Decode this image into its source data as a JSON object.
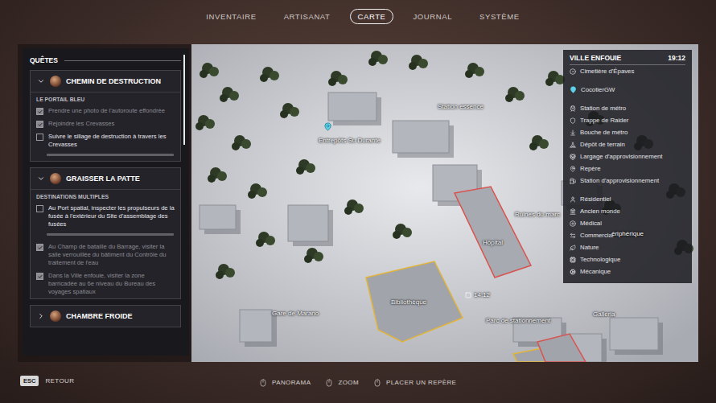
{
  "nav": {
    "tabs": [
      {
        "label": "INVENTAIRE",
        "selected": false
      },
      {
        "label": "ARTISANAT",
        "selected": false
      },
      {
        "label": "CARTE",
        "selected": true
      },
      {
        "label": "JOURNAL",
        "selected": false
      },
      {
        "label": "SYSTÈME",
        "selected": false
      }
    ]
  },
  "quests": {
    "title": "QUÊTES",
    "items": [
      {
        "title": "CHEMIN DE DESTRUCTION",
        "expanded": true,
        "subtitle": "LE PORTAIL BLEU",
        "objectives": [
          {
            "text": "Prendre une photo de l'autoroute effondrée",
            "checked": true
          },
          {
            "text": "Rejoindre les Crevasses",
            "checked": true
          },
          {
            "text": "Suivre le sillage de destruction à travers les Crevasses",
            "checked": false
          }
        ]
      },
      {
        "title": "GRAISSER LA PATTE",
        "expanded": true,
        "subtitle": "DESTINATIONS MULTIPLES",
        "objectives": [
          {
            "text": "Au Port spatial, inspecter les propulseurs de la fusée à l'extérieur du Site d'assemblage des fusées",
            "checked": false
          },
          {
            "text": "Au Champ de bataille du Barrage, visiter la salle verrouillée du bâtiment du Contrôle du traitement de l'eau",
            "checked": true
          },
          {
            "text": "Dans la Ville enfouie, visiter la zone barricadée au 6e niveau du Bureau des voyages spatiaux",
            "checked": true
          }
        ]
      },
      {
        "title": "CHAMBRE FROIDE",
        "expanded": false,
        "subtitle": "",
        "objectives": []
      }
    ]
  },
  "map": {
    "labels": [
      "Station essence",
      "Entrepôts Su Durante",
      "Ruines du marc",
      "Hôpital",
      "Bibliothèque",
      "14:12",
      "Gare de Marano",
      "Parc de stationnement",
      "Galleria",
      "ériphérique"
    ]
  },
  "legend": {
    "title": "VILLE ENFOUIE",
    "time": "19:12",
    "region": "Cimetière d'Épaves",
    "player": "CocotierGW",
    "markers": [
      "Station de métro",
      "Trappe de Raider",
      "Bouche de métro",
      "Dépôt de terrain",
      "Largage d'approvisionnement",
      "Repère",
      "Station d'approvisionnement"
    ],
    "zones": [
      "Résidentiel",
      "Ancien monde",
      "Médical",
      "Commercial",
      "Nature",
      "Technologique",
      "Mécanique"
    ]
  },
  "footer": {
    "back_key": "ESC",
    "back_label": "RETOUR",
    "hints": [
      "PANORAMA",
      "ZOOM",
      "PLACER UN REPÈRE"
    ]
  }
}
